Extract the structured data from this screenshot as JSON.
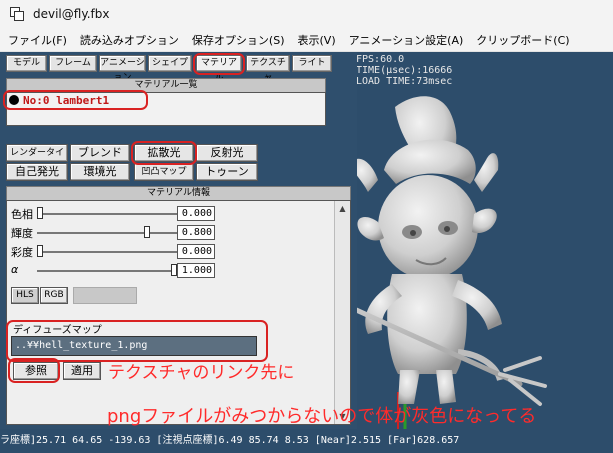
{
  "window": {
    "title": "devil@fly.fbx"
  },
  "menu": [
    "ファイル(F)",
    "読み込みオプション",
    "保存オプション(S)",
    "表示(V)",
    "アニメーション設定(A)",
    "クリップボード(C)"
  ],
  "tabs": [
    "モデル",
    "フレーム",
    "アニメーション",
    "シェイプ",
    "マテリアル",
    "テクスチャ",
    "ライト"
  ],
  "material_list": {
    "header": "マテリアル一覧",
    "items": [
      "No:0 lambert1"
    ]
  },
  "prop_buttons": [
    "レンダータイプ",
    "ブレンド",
    "拡散光",
    "反射光",
    "自己発光",
    "環境光",
    "凹凸マップ",
    "トゥーン"
  ],
  "material_info": {
    "header": "マテリアル情報",
    "sliders": [
      {
        "label": "色相",
        "value": "0.000",
        "level": 0.0
      },
      {
        "label": "輝度",
        "value": "0.800",
        "level": 0.8
      },
      {
        "label": "彩度",
        "value": "0.000",
        "level": 0.0
      },
      {
        "label": "α",
        "value": "1.000",
        "level": 1.0
      }
    ],
    "mode_buttons": [
      "HLS",
      "RGB"
    ],
    "diffuse_map_label": "ディフューズマップ",
    "diffuse_map_path": "..¥¥hell_texture_1.png",
    "ref_button": "参照",
    "apply_button": "適用"
  },
  "overlay": {
    "fps": "FPS:60.0",
    "time": "TIME(μsec):16666",
    "load": "LOAD TIME:73msec"
  },
  "status": "ラ座標]25.71 64.65 -139.63 [注視点座標]6.49 85.74 8.53 [Near]2.515 [Far]628.657",
  "annotations": {
    "line1": "テクスチャのリンク先に",
    "line2": "pngファイルがみつからないので体が灰色になってる"
  },
  "colors": {
    "annotation_red": "#d92222",
    "viewport_bg": "#2d4d6b",
    "model_gray": "#d8d8d8"
  }
}
